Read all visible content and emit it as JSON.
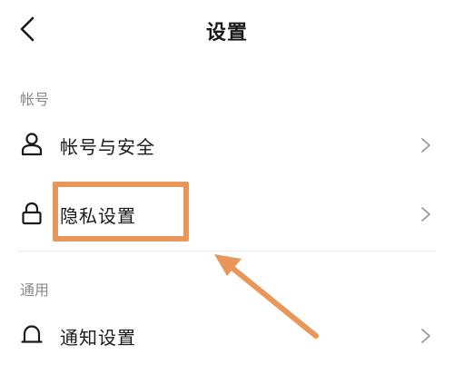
{
  "header": {
    "title": "设置",
    "back_icon": "chevron-left-icon"
  },
  "sections": [
    {
      "label": "帐号",
      "items": [
        {
          "label": "帐号与安全",
          "icon": "user-icon"
        },
        {
          "label": "隐私设置",
          "icon": "lock-icon"
        }
      ]
    },
    {
      "label": "通用",
      "items": [
        {
          "label": "通知设置",
          "icon": "bell-icon"
        }
      ]
    }
  ],
  "annotation": {
    "color": "#e8965a"
  }
}
